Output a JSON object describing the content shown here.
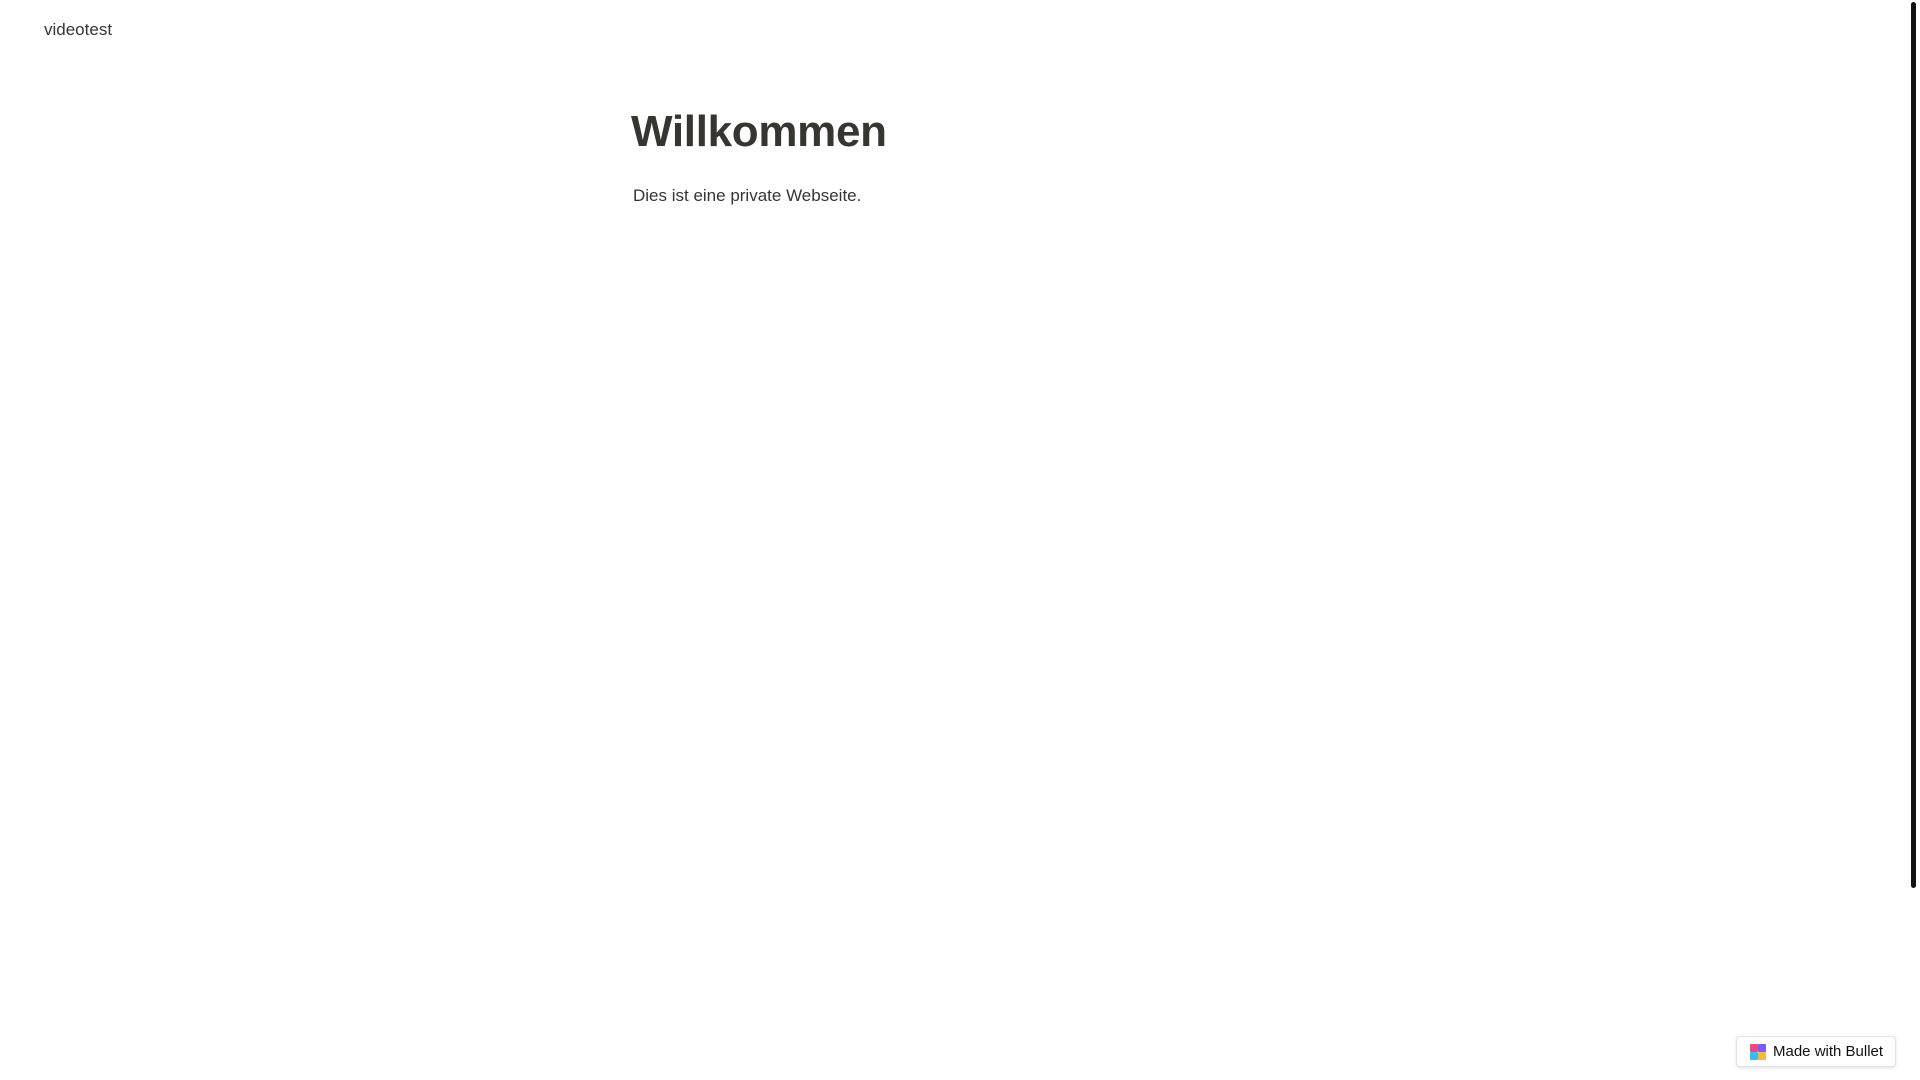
{
  "site": {
    "title": "videotest"
  },
  "main": {
    "heading": "Willkommen",
    "paragraph": "Dies ist eine private Webseite."
  },
  "badge": {
    "label": "Made with Bullet",
    "icon": "bullet-logo-icon"
  },
  "colors": {
    "text": "#37352f",
    "background": "#ffffff",
    "scrollbar_thumb": "#111111"
  }
}
